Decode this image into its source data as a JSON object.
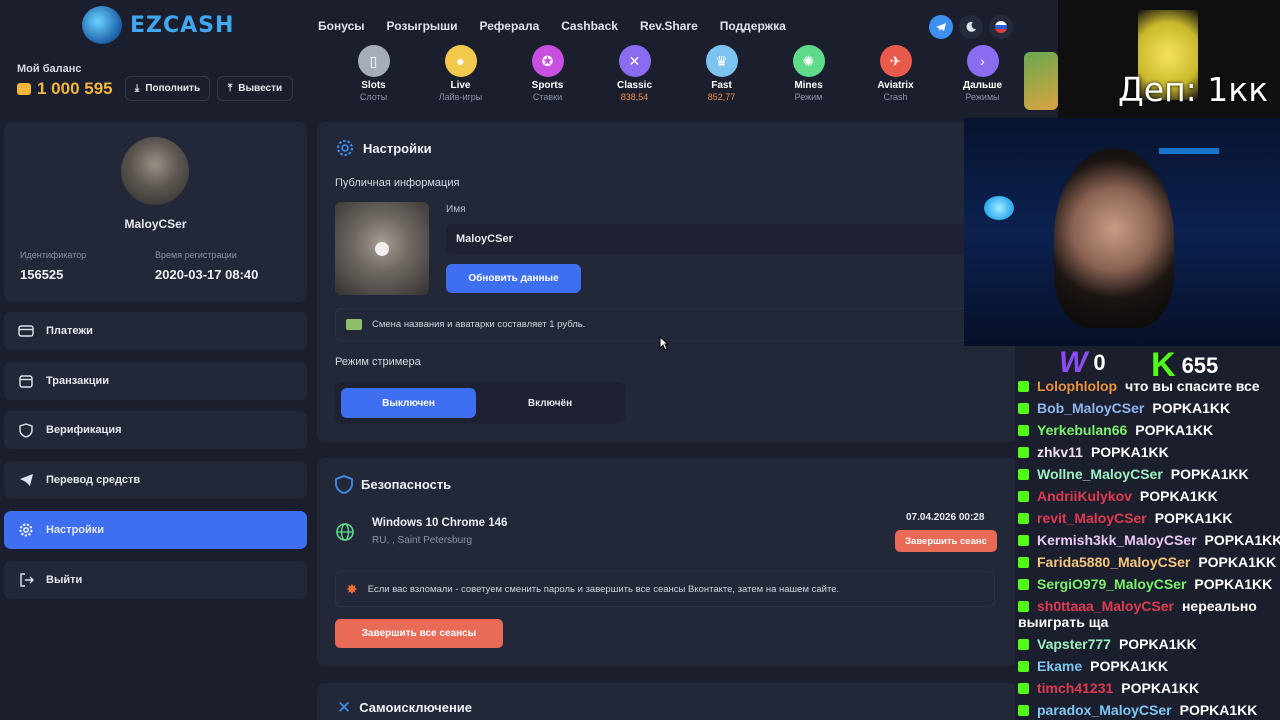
{
  "header": {
    "logo": "EZCASH",
    "nav": [
      "Бонусы",
      "Розыгрыши",
      "Реферала",
      "Cashback",
      "Rev.Share",
      "Поддержка"
    ],
    "icons": [
      "telegram-icon",
      "moon-icon",
      "flag-ru-icon"
    ]
  },
  "balance": {
    "label": "Мой баланс",
    "value": "1 000 595",
    "deposit": "Пополнить",
    "withdraw": "Вывести"
  },
  "games": [
    {
      "name": "Slots",
      "sub": "Слоты",
      "color": "#a7acbb",
      "icon": "cards-icon"
    },
    {
      "name": "Live",
      "sub": "Лайв-игры",
      "color": "#f2c94c",
      "icon": "person-icon"
    },
    {
      "name": "Sports",
      "sub": "Ставки",
      "color": "#c84fe0",
      "icon": "ball-icon"
    },
    {
      "name": "Classic",
      "sub": "838,54",
      "color": "#8a6cf0",
      "icon": "swords-icon",
      "orange": true
    },
    {
      "name": "Fast",
      "sub": "852,77",
      "color": "#7cc3f0",
      "icon": "crown-icon",
      "orange": true
    },
    {
      "name": "Mines",
      "sub": "Режим",
      "color": "#5fd98a",
      "icon": "mine-icon"
    },
    {
      "name": "Aviatrix",
      "sub": "Crash",
      "color": "#ea5a4a",
      "icon": "plane-icon"
    },
    {
      "name": "Дальше",
      "sub": "Режимы",
      "color": "#8a6cf0",
      "icon": "chevron-right-icon"
    }
  ],
  "profile": {
    "name": "MaloyCSer",
    "id_label": "Идентификатор",
    "id_value": "156525",
    "reg_label": "Время регистрации",
    "reg_value": "2020-03-17 08:40"
  },
  "menu": [
    {
      "label": "Платежи",
      "icon": "card-icon"
    },
    {
      "label": "Транзакции",
      "icon": "calendar-icon"
    },
    {
      "label": "Верификация",
      "icon": "shield-icon"
    },
    {
      "label": "Перевод средств",
      "icon": "send-icon"
    },
    {
      "label": "Настройки",
      "icon": "gear-icon",
      "active": true
    },
    {
      "label": "Выйти",
      "icon": "logout-icon"
    }
  ],
  "settings": {
    "title": "Настройки",
    "public_info": "Публичная информация",
    "name_label": "Имя",
    "name_value": "MaloyCSer",
    "update_btn": "Обновить данные",
    "note": "Смена названия и аватарки составляет 1 рубль.",
    "streamer_mode": "Режим стримера",
    "off_label": "Выключен",
    "on_label": "Включён"
  },
  "security": {
    "title": "Безопасность",
    "device": "Windows 10 Chrome 146",
    "location": "RU, , Saint Petersburg",
    "date": "07.04.2026 00:28",
    "end_session": "Завершить сеанс",
    "warning": "Если вас взломали - советуем сменить пароль и завершить все сеансы Вконтакте, затем на нашем сайте.",
    "end_all": "Завершить все сеансы"
  },
  "self_exclusion": {
    "title": "Самоисключение"
  },
  "overlay": {
    "deposit": "Деп: 1кк",
    "w_count": "0",
    "k_count": "655"
  },
  "chat": [
    {
      "user": "Lolophlolop",
      "msg": "что вы спасите все",
      "color": "#e8923a"
    },
    {
      "user": "Bob_MaloyCSer",
      "msg": "POPKA1KK",
      "color": "#8fb5f0"
    },
    {
      "user": "Yerkebulan66",
      "msg": "POPKA1KK",
      "color": "#7bf06a"
    },
    {
      "user": "zhkv11",
      "msg": "POPKA1KK",
      "color": "#f2e0f0"
    },
    {
      "user": "Wollne_MaloyCSer",
      "msg": "POPKA1KK",
      "color": "#9cf0c0"
    },
    {
      "user": "AndriiKulykov",
      "msg": "POPKA1KK",
      "color": "#e03a50"
    },
    {
      "user": "revit_MaloyCSer",
      "msg": "POPKA1KK",
      "color": "#e03a50"
    },
    {
      "user": "Kermish3kk_MaloyCSer",
      "msg": "POPKA1KK",
      "color": "#e8c8f5"
    },
    {
      "user": "Farida5880_MaloyCSer",
      "msg": "POPKA1KK",
      "color": "#f4c67a"
    },
    {
      "user": "SergiO979_MaloyCSer",
      "msg": "POPKA1KK",
      "color": "#7bf06a"
    },
    {
      "user": "sh0ttaaa_MaloyCSer",
      "msg": "нереально",
      "color": "#e03a50",
      "cont": "выиграть ща"
    },
    {
      "user": "Vapster777",
      "msg": "POPKA1KK",
      "color": "#9cf0c0"
    },
    {
      "user": "Ekame",
      "msg": "POPKA1KK",
      "color": "#7ec7f2"
    },
    {
      "user": "timch41231",
      "msg": "POPKA1KK",
      "color": "#e03a50"
    },
    {
      "user": "paradox_MaloyCSer",
      "msg": "POPKA1KK",
      "color": "#7ec7f2"
    }
  ]
}
